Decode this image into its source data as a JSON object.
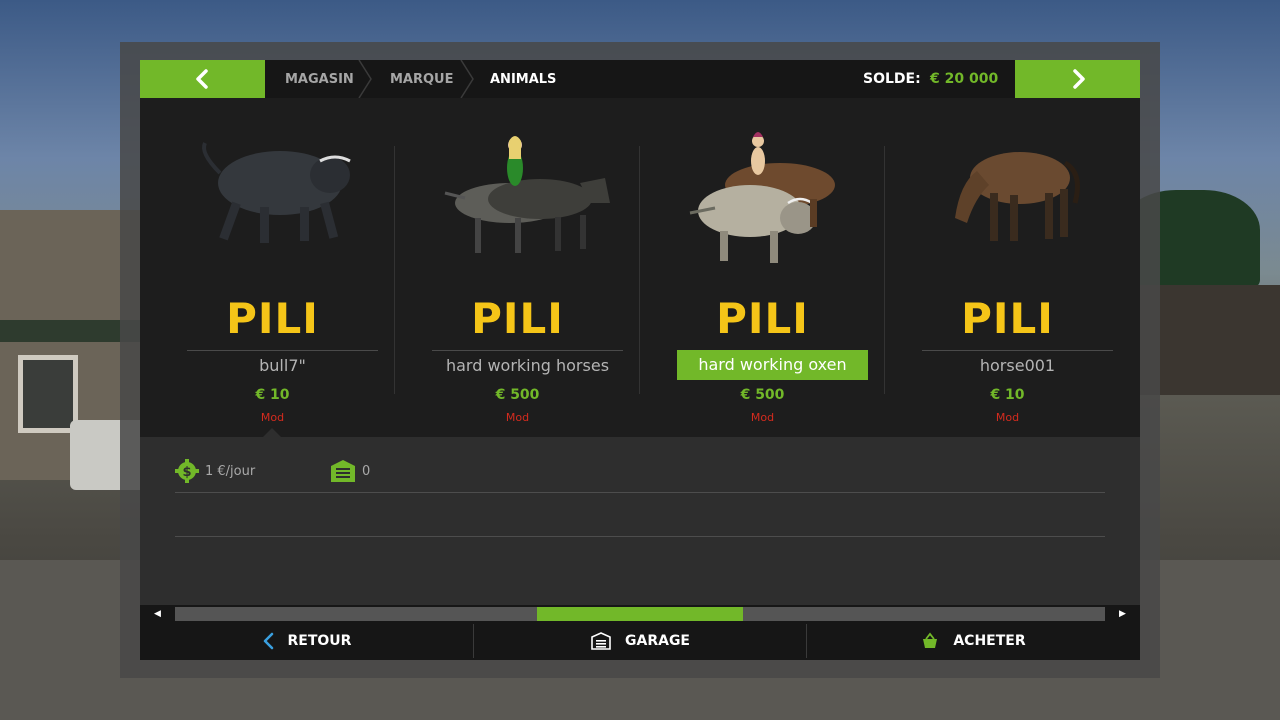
{
  "header": {
    "breadcrumbs": [
      "MAGASIN",
      "MARQUE",
      "ANIMALS"
    ],
    "balance_label": "SOLDE:",
    "balance_value": "€ 20 000",
    "prev_icon": "chevron-left-icon",
    "next_icon": "chevron-right-icon"
  },
  "items": [
    {
      "brand": "PILI",
      "name": "bull7\"",
      "price": "€ 10",
      "tag": "Mod",
      "selected": false,
      "image": "bull"
    },
    {
      "brand": "PILI",
      "name": "hard working horses",
      "price": "€ 500",
      "tag": "Mod",
      "selected": false,
      "image": "horses-with-rider"
    },
    {
      "brand": "PILI",
      "name": "hard working oxen",
      "price": "€ 500",
      "tag": "Mod",
      "selected": true,
      "image": "oxen-with-rider"
    },
    {
      "brand": "PILI",
      "name": "horse001",
      "price": "€ 10",
      "tag": "Mod",
      "selected": false,
      "image": "horse"
    }
  ],
  "details": {
    "maintenance": {
      "icon": "dollar-gear-icon",
      "value": "1 €/jour"
    },
    "garage_count": {
      "icon": "garage-icon",
      "value": "0"
    }
  },
  "scrollbar": {
    "position": 0.39,
    "visible_fraction": 0.22
  },
  "footer": {
    "back_label": "RETOUR",
    "garage_label": "GARAGE",
    "buy_label": "ACHETER"
  },
  "colors": {
    "accent": "#72b829",
    "brand": "#f5c518",
    "mod": "#d42b1e"
  }
}
